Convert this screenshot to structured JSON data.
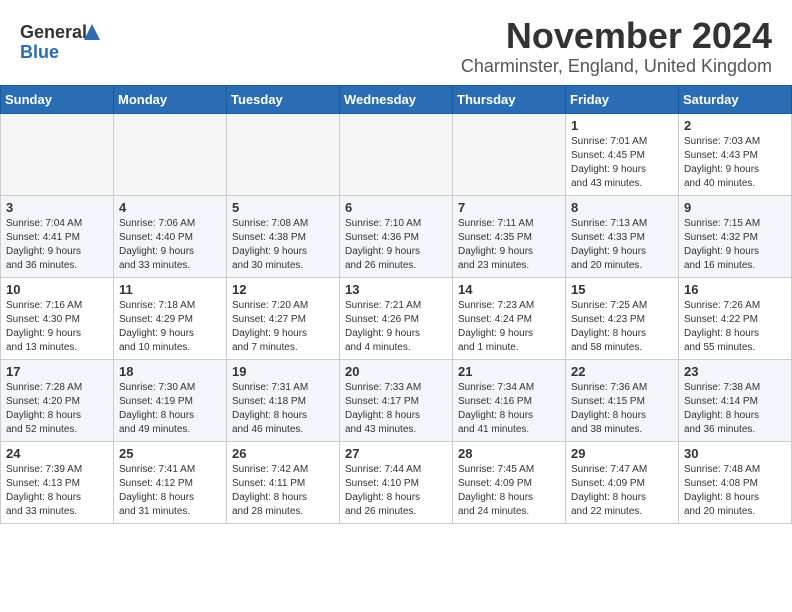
{
  "header": {
    "logo_general": "General",
    "logo_blue": "Blue",
    "title": "November 2024",
    "subtitle": "Charminster, England, United Kingdom"
  },
  "days_of_week": [
    "Sunday",
    "Monday",
    "Tuesday",
    "Wednesday",
    "Thursday",
    "Friday",
    "Saturday"
  ],
  "weeks": [
    [
      {
        "day": "",
        "info": ""
      },
      {
        "day": "",
        "info": ""
      },
      {
        "day": "",
        "info": ""
      },
      {
        "day": "",
        "info": ""
      },
      {
        "day": "",
        "info": ""
      },
      {
        "day": "1",
        "info": "Sunrise: 7:01 AM\nSunset: 4:45 PM\nDaylight: 9 hours\nand 43 minutes."
      },
      {
        "day": "2",
        "info": "Sunrise: 7:03 AM\nSunset: 4:43 PM\nDaylight: 9 hours\nand 40 minutes."
      }
    ],
    [
      {
        "day": "3",
        "info": "Sunrise: 7:04 AM\nSunset: 4:41 PM\nDaylight: 9 hours\nand 36 minutes."
      },
      {
        "day": "4",
        "info": "Sunrise: 7:06 AM\nSunset: 4:40 PM\nDaylight: 9 hours\nand 33 minutes."
      },
      {
        "day": "5",
        "info": "Sunrise: 7:08 AM\nSunset: 4:38 PM\nDaylight: 9 hours\nand 30 minutes."
      },
      {
        "day": "6",
        "info": "Sunrise: 7:10 AM\nSunset: 4:36 PM\nDaylight: 9 hours\nand 26 minutes."
      },
      {
        "day": "7",
        "info": "Sunrise: 7:11 AM\nSunset: 4:35 PM\nDaylight: 9 hours\nand 23 minutes."
      },
      {
        "day": "8",
        "info": "Sunrise: 7:13 AM\nSunset: 4:33 PM\nDaylight: 9 hours\nand 20 minutes."
      },
      {
        "day": "9",
        "info": "Sunrise: 7:15 AM\nSunset: 4:32 PM\nDaylight: 9 hours\nand 16 minutes."
      }
    ],
    [
      {
        "day": "10",
        "info": "Sunrise: 7:16 AM\nSunset: 4:30 PM\nDaylight: 9 hours\nand 13 minutes."
      },
      {
        "day": "11",
        "info": "Sunrise: 7:18 AM\nSunset: 4:29 PM\nDaylight: 9 hours\nand 10 minutes."
      },
      {
        "day": "12",
        "info": "Sunrise: 7:20 AM\nSunset: 4:27 PM\nDaylight: 9 hours\nand 7 minutes."
      },
      {
        "day": "13",
        "info": "Sunrise: 7:21 AM\nSunset: 4:26 PM\nDaylight: 9 hours\nand 4 minutes."
      },
      {
        "day": "14",
        "info": "Sunrise: 7:23 AM\nSunset: 4:24 PM\nDaylight: 9 hours\nand 1 minute."
      },
      {
        "day": "15",
        "info": "Sunrise: 7:25 AM\nSunset: 4:23 PM\nDaylight: 8 hours\nand 58 minutes."
      },
      {
        "day": "16",
        "info": "Sunrise: 7:26 AM\nSunset: 4:22 PM\nDaylight: 8 hours\nand 55 minutes."
      }
    ],
    [
      {
        "day": "17",
        "info": "Sunrise: 7:28 AM\nSunset: 4:20 PM\nDaylight: 8 hours\nand 52 minutes."
      },
      {
        "day": "18",
        "info": "Sunrise: 7:30 AM\nSunset: 4:19 PM\nDaylight: 8 hours\nand 49 minutes."
      },
      {
        "day": "19",
        "info": "Sunrise: 7:31 AM\nSunset: 4:18 PM\nDaylight: 8 hours\nand 46 minutes."
      },
      {
        "day": "20",
        "info": "Sunrise: 7:33 AM\nSunset: 4:17 PM\nDaylight: 8 hours\nand 43 minutes."
      },
      {
        "day": "21",
        "info": "Sunrise: 7:34 AM\nSunset: 4:16 PM\nDaylight: 8 hours\nand 41 minutes."
      },
      {
        "day": "22",
        "info": "Sunrise: 7:36 AM\nSunset: 4:15 PM\nDaylight: 8 hours\nand 38 minutes."
      },
      {
        "day": "23",
        "info": "Sunrise: 7:38 AM\nSunset: 4:14 PM\nDaylight: 8 hours\nand 36 minutes."
      }
    ],
    [
      {
        "day": "24",
        "info": "Sunrise: 7:39 AM\nSunset: 4:13 PM\nDaylight: 8 hours\nand 33 minutes."
      },
      {
        "day": "25",
        "info": "Sunrise: 7:41 AM\nSunset: 4:12 PM\nDaylight: 8 hours\nand 31 minutes."
      },
      {
        "day": "26",
        "info": "Sunrise: 7:42 AM\nSunset: 4:11 PM\nDaylight: 8 hours\nand 28 minutes."
      },
      {
        "day": "27",
        "info": "Sunrise: 7:44 AM\nSunset: 4:10 PM\nDaylight: 8 hours\nand 26 minutes."
      },
      {
        "day": "28",
        "info": "Sunrise: 7:45 AM\nSunset: 4:09 PM\nDaylight: 8 hours\nand 24 minutes."
      },
      {
        "day": "29",
        "info": "Sunrise: 7:47 AM\nSunset: 4:09 PM\nDaylight: 8 hours\nand 22 minutes."
      },
      {
        "day": "30",
        "info": "Sunrise: 7:48 AM\nSunset: 4:08 PM\nDaylight: 8 hours\nand 20 minutes."
      }
    ]
  ]
}
